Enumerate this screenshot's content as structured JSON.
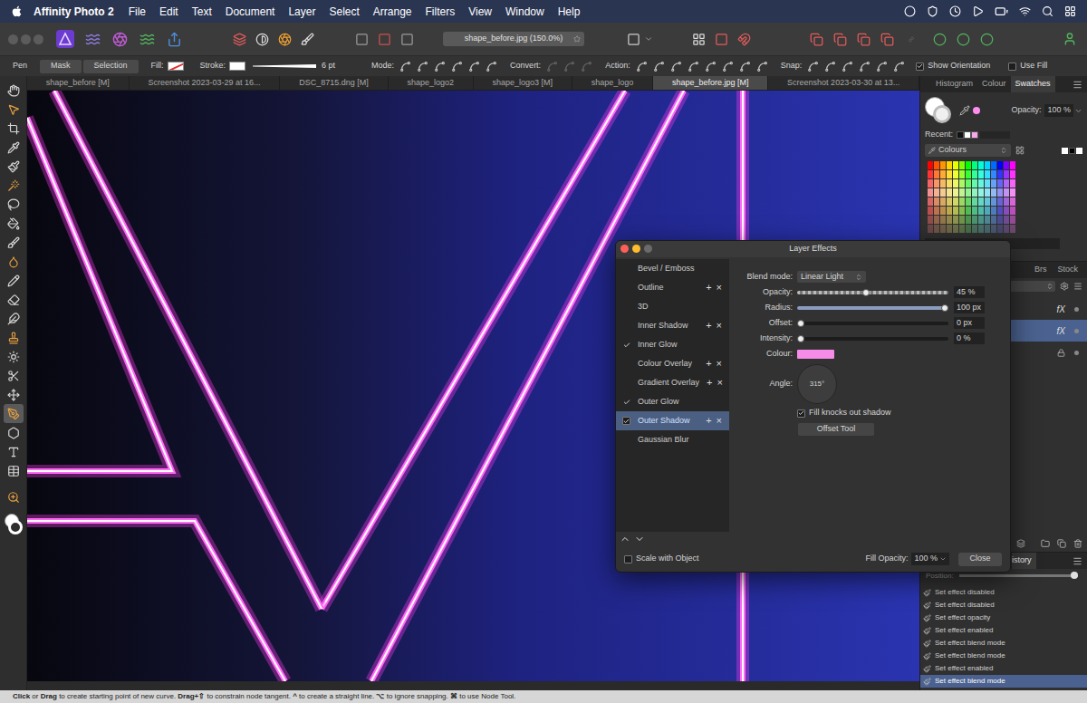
{
  "menubar": {
    "app": "Affinity Photo 2",
    "items": [
      "File",
      "Edit",
      "Text",
      "Document",
      "Layer",
      "Select",
      "Arrange",
      "Filters",
      "View",
      "Window",
      "Help"
    ]
  },
  "toolbar": {
    "document_title": "shape_before.jpg (150.0%)"
  },
  "context_toolbar": {
    "tool": "Pen",
    "buttons": [
      {
        "label": "Mask",
        "selected": false
      },
      {
        "label": "Selection",
        "selected": false
      }
    ],
    "fill_label": "Fill:",
    "stroke_label": "Stroke:",
    "stroke_width": "6 pt",
    "mode_label": "Mode:",
    "convert_label": "Convert:",
    "action_label": "Action:",
    "snap_label": "Snap:",
    "options": [
      {
        "label": "Show Orientation",
        "checked": true
      },
      {
        "label": "Use Fill",
        "checked": false
      }
    ]
  },
  "document_tabs": [
    {
      "label": "shape_before [M]",
      "selected": false
    },
    {
      "label": "Screenshot 2023-03-29 at 16...",
      "selected": false
    },
    {
      "label": "DSC_8715.dng [M]",
      "selected": false
    },
    {
      "label": "shape_logo2",
      "selected": false
    },
    {
      "label": "shape_logo3 [M]",
      "selected": false
    },
    {
      "label": "shape_logo",
      "selected": false
    },
    {
      "label": "shape_before.jpg [M]",
      "selected": true
    },
    {
      "label": "Screenshot 2023-03-30 at 13...",
      "selected": false
    }
  ],
  "tools": [
    {
      "selected": false
    },
    {
      "selected": false
    },
    {
      "selected": false
    },
    {
      "selected": false
    },
    {
      "selected": false
    },
    {
      "selected": false
    },
    {
      "selected": false
    },
    {
      "selected": false
    },
    {
      "selected": false
    },
    {
      "selected": false
    },
    {
      "selected": false
    },
    {
      "selected": false
    },
    {
      "selected": false
    },
    {
      "selected": false
    },
    {
      "selected": false
    },
    {
      "selected": false
    },
    {
      "selected": false
    },
    {
      "selected": true
    },
    {
      "selected": false
    },
    {
      "selected": false
    },
    {
      "selected": false
    },
    {
      "selected": false
    }
  ],
  "swatches_panel": {
    "tabs": [
      {
        "label": "Histogram",
        "selected": false
      },
      {
        "label": "Colour",
        "selected": false
      },
      {
        "label": "Swatches",
        "selected": true
      }
    ],
    "opacity_label": "Opacity:",
    "opacity": "100 %",
    "recent_label": "Recent:",
    "recent": [
      "#111111",
      "#ffffff",
      "#f7a8ee"
    ],
    "palette": "Colours",
    "grid": {
      "hues": [
        0,
        20,
        35,
        50,
        65,
        90,
        120,
        150,
        170,
        190,
        215,
        240,
        270,
        300
      ],
      "saturation": [
        100,
        100,
        90,
        80,
        60,
        45,
        32,
        22
      ],
      "lightness": [
        50,
        60,
        68,
        76,
        62,
        52,
        44,
        36
      ]
    }
  },
  "layers_panel": {
    "tabs": [
      {
        "label": "Brs",
        "selected": false
      },
      {
        "label": "Stock",
        "selected": false
      }
    ],
    "layers": [
      {
        "badge": "fX",
        "selected": false,
        "locked": false
      },
      {
        "badge": "fX",
        "selected": true,
        "locked": false
      },
      {
        "badge": "",
        "selected": false,
        "locked": true
      }
    ]
  },
  "history_panel": {
    "tab": "istory",
    "position_label": "Position:",
    "position_level": 1,
    "items": [
      {
        "label": "Set effect disabled",
        "selected": false
      },
      {
        "label": "Set effect disabled",
        "selected": false
      },
      {
        "label": "Set effect opacity",
        "selected": false
      },
      {
        "label": "Set effect enabled",
        "selected": false
      },
      {
        "label": "Set effect blend mode",
        "selected": false
      },
      {
        "label": "Set effect blend mode",
        "selected": false
      },
      {
        "label": "Set effect enabled",
        "selected": false
      },
      {
        "label": "Set effect blend mode",
        "selected": true
      }
    ]
  },
  "layer_effects": {
    "title": "Layer Effects",
    "item_actions": [
      "+",
      "×"
    ],
    "effects": [
      {
        "label": "Bevel / Emboss",
        "enabled": false,
        "selected": false,
        "has_actions": false
      },
      {
        "label": "Outline",
        "enabled": false,
        "selected": false,
        "has_actions": true
      },
      {
        "label": "3D",
        "enabled": false,
        "selected": false,
        "has_actions": false
      },
      {
        "label": "Inner Shadow",
        "enabled": false,
        "selected": false,
        "has_actions": true
      },
      {
        "label": "Inner Glow",
        "enabled": true,
        "selected": false,
        "has_actions": false
      },
      {
        "label": "Colour Overlay",
        "enabled": false,
        "selected": false,
        "has_actions": true
      },
      {
        "label": "Gradient Overlay",
        "enabled": false,
        "selected": false,
        "has_actions": true
      },
      {
        "label": "Outer Glow",
        "enabled": true,
        "selected": false,
        "has_actions": false
      },
      {
        "label": "Outer Shadow",
        "enabled": true,
        "selected": true,
        "has_actions": true
      },
      {
        "label": "Gaussian Blur",
        "enabled": false,
        "selected": false,
        "has_actions": false
      }
    ],
    "blend_mode_label": "Blend mode:",
    "blend_mode": "Linear Light",
    "sliders": [
      {
        "label": "Opacity:",
        "value": "45 %",
        "level": 0.45,
        "kind": "checker"
      },
      {
        "label": "Radius:",
        "value": "100 px",
        "level": 1,
        "kind": "plain"
      },
      {
        "label": "Offset:",
        "value": "0 px",
        "level": 0,
        "kind": "plain"
      },
      {
        "label": "Intensity:",
        "value": "0 %",
        "level": 0,
        "kind": "plain"
      }
    ],
    "colour_label": "Colour:",
    "colour": "#f78be8",
    "angle_label": "Angle:",
    "angle": "315°",
    "fill_knocks_out": {
      "label": "Fill knocks out shadow",
      "checked": true
    },
    "offset_tool": "Offset Tool",
    "scale_with_object": {
      "label": "Scale with Object",
      "checked": false
    },
    "fill_opacity_label": "Fill Opacity:",
    "fill_opacity": "100 %",
    "close": "Close"
  },
  "status_bar": {
    "segments": [
      {
        "text": "Click",
        "bold": true
      },
      {
        "text": " or ",
        "bold": false
      },
      {
        "text": "Drag",
        "bold": true
      },
      {
        "text": " to create starting point of new curve. ",
        "bold": false
      },
      {
        "text": "Drag+⇧",
        "bold": true
      },
      {
        "text": " to constrain node tangent. ",
        "bold": false
      },
      {
        "text": "^",
        "bold": true
      },
      {
        "text": " to create a straight line. ",
        "bold": false
      },
      {
        "text": "⌥",
        "bold": true
      },
      {
        "text": " to ignore snapping. ",
        "bold": false
      },
      {
        "text": "⌘",
        "bold": true
      },
      {
        "text": " to use Node Tool.",
        "bold": false
      }
    ]
  }
}
